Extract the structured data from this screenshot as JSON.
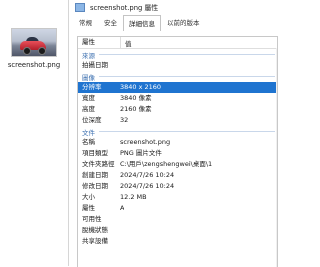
{
  "desktop_file": {
    "label": "screenshot.png"
  },
  "window": {
    "title": "screenshot.png 屬性",
    "tabs": [
      {
        "label": "常規"
      },
      {
        "label": "安全"
      },
      {
        "label": "詳細信息"
      },
      {
        "label": "以前的版本"
      }
    ],
    "active_tab": 2,
    "table": {
      "header_name": "屬性",
      "header_value": "值",
      "source": {
        "title": "來源",
        "rows": [
          {
            "name": "拍攝日期",
            "value": ""
          }
        ]
      },
      "image": {
        "title": "圖像",
        "rows": [
          {
            "name": "分辨率",
            "value": "3840 x 2160"
          },
          {
            "name": "寬度",
            "value": "3840 像素"
          },
          {
            "name": "高度",
            "value": "2160 像素"
          },
          {
            "name": "位深度",
            "value": "32"
          }
        ]
      },
      "file": {
        "title": "文件",
        "rows": [
          {
            "name": "名稱",
            "value": "screenshot.png"
          },
          {
            "name": "項目類型",
            "value": "PNG 圖片文件"
          },
          {
            "name": "文件夾路徑",
            "value": "C:\\用戶\\zengshengwei\\桌面\\1"
          },
          {
            "name": "創建日期",
            "value": "2024/7/26 10:24"
          },
          {
            "name": "修改日期",
            "value": "2024/7/26 10:24"
          },
          {
            "name": "大小",
            "value": "12.2 MB"
          },
          {
            "name": "屬性",
            "value": "A"
          },
          {
            "name": "可用性",
            "value": ""
          },
          {
            "name": "脫機狀態",
            "value": ""
          },
          {
            "name": "共享設備",
            "value": ""
          }
        ]
      }
    }
  }
}
